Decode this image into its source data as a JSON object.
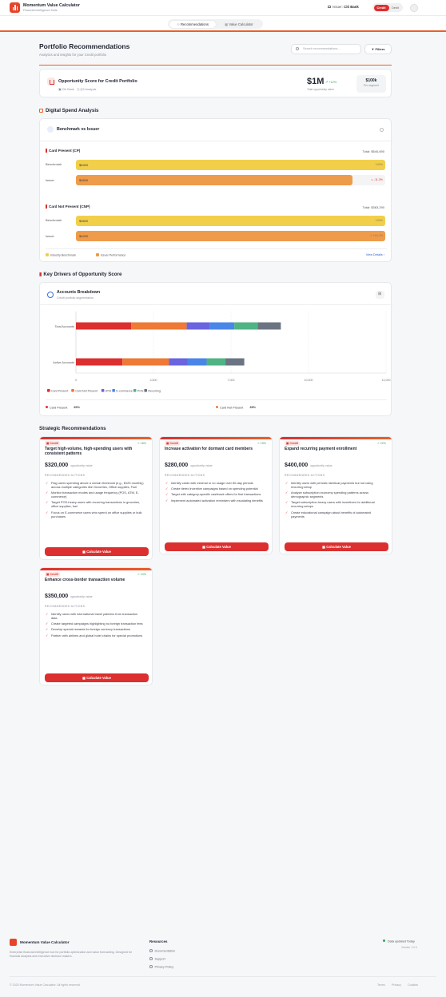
{
  "header": {
    "app_title": "Momentum Value Calculator",
    "app_subtitle": "Financial Intelligence Suite",
    "issuer_label": "Issuer:",
    "issuer_name": "Citi Bank",
    "toggle": {
      "credit": "Credit",
      "debit": "Debit"
    },
    "tabs": [
      {
        "label": "Recommendations"
      },
      {
        "label": "Value Calculator"
      }
    ]
  },
  "page": {
    "title": "Portfolio Recommendations",
    "subtitle": "Analytics and insights for your Credit portfolio",
    "search_placeholder": "Search recommendations...",
    "filters_label": "Filters"
  },
  "opportunity": {
    "title": "Opportunity Score for Credit Portfolio",
    "bank": "Citi Bank",
    "period": "Q3 Analysis",
    "value": "$1M",
    "delta": "+12%",
    "value_label": "Total opportunity value",
    "segment_value": "$100k",
    "segment_label": "Per segment"
  },
  "digital_spend": {
    "section_title": "Digital Spend Analysis",
    "card_title": "Benchmark vs Issuer",
    "groups": [
      {
        "title": "Card Present (CP)",
        "total": "Total: $540,690",
        "rows": [
          {
            "label": "Benchmark",
            "value": "$6400",
            "pct_text": "100%",
            "fill": 1.0,
            "color": "#f2cf4a"
          },
          {
            "label": "Issuer",
            "value": "$4600",
            "pct_text": "↘ -11.3%",
            "fill": 0.895,
            "color": "#ee9b4b"
          }
        ]
      },
      {
        "title": "Card Not Present (CNP)",
        "total": "Total: $363,290",
        "rows": [
          {
            "label": "Benchmark",
            "value": "$3600",
            "pct_text": "100%",
            "fill": 1.0,
            "color": "#f2cf4a"
          },
          {
            "label": "Issuer",
            "value": "$4200",
            "pct_text": "↗ +16.7%",
            "fill": 1.0,
            "color": "#ee9b4b"
          }
        ]
      }
    ],
    "legend": [
      {
        "label": "Industry Benchmark",
        "color": "#f2cf4a"
      },
      {
        "label": "Issuer Performance",
        "color": "#ee9b4b"
      }
    ],
    "view_details": "View Details ›"
  },
  "key_drivers": {
    "section_title": "Key Drivers of Opportunity Score",
    "card_title": "Accounts Breakdown",
    "card_subtitle": "Credit portfolio segmentation",
    "footer": [
      {
        "label": "Card Present",
        "value": "89%",
        "color": "#dc2f2f"
      },
      {
        "label": "Card Not Present",
        "value": "38%",
        "color": "#ee7a35"
      }
    ]
  },
  "chart_data": {
    "type": "bar",
    "orientation": "horizontal",
    "stacked": true,
    "categories": [
      "Total Accounts",
      "Active Accounts"
    ],
    "series": [
      {
        "name": "Card Present",
        "color": "#dc2f2f",
        "values": [
          2500,
          2100
        ]
      },
      {
        "name": "Card Not Present",
        "color": "#ee7a35",
        "values": [
          2500,
          2100
        ]
      },
      {
        "name": "ATM",
        "color": "#6a64e0",
        "values": [
          1050,
          850
        ]
      },
      {
        "name": "E-commerce",
        "color": "#4a86e8",
        "values": [
          1100,
          850
        ]
      },
      {
        "name": "POS",
        "color": "#4fb483",
        "values": [
          1050,
          850
        ]
      },
      {
        "name": "Recurring",
        "color": "#6b7483",
        "values": [
          1050,
          850
        ]
      }
    ],
    "xlim": [
      0,
      14000
    ],
    "xticks": [
      "0",
      "3,500",
      "7,000",
      "10,500",
      "14,000"
    ],
    "grid": true,
    "legend_position": "bottom-left"
  },
  "strategic": {
    "section_title": "Strategic Recommendations",
    "button_label": "Calculate Value",
    "value_suffix": "opportunity value",
    "actions_heading": "RECOMMENDED ACTIONS",
    "cards": [
      {
        "badge": "Credit",
        "growth": "↗ 18%",
        "title": "Target high-volume, high-spending users with consistent patterns",
        "value": "$320,000",
        "actions": [
          "Flag users spending above a certain threshold (e.g., $125 monthly) across multiple categories like Groceries, Office supplies, Fuel",
          "Monitor transaction modes and usage frequency (POS, ATM, E-commerce)",
          "Target POS-heavy users with recurring transactions in groceries, office supplies, fuel",
          "Focus on E-commerce users who spend on office supplies or bulk purchases"
        ]
      },
      {
        "badge": "Credit",
        "growth": "↗ 15%",
        "title": "Increase activation for dormant card members",
        "value": "$280,000",
        "actions": [
          "Identify cards with minimal or no usage over 60-day periods",
          "Create tiered incentive campaigns based on spending potential",
          "Target with category-specific cashback offers for first transactions",
          "Implement automated activation reminders with escalating benefits"
        ]
      },
      {
        "badge": "Credit",
        "growth": "↗ 22%",
        "title": "Expand recurring payment enrollment",
        "value": "$400,000",
        "actions": [
          "Identify users with periodic identical payments but not using recurring setup",
          "Analyze subscription economy spending patterns across demographic segments",
          "Target subscription-heavy users with incentives for additional recurring setups",
          "Create educational campaign about benefits of automated payments"
        ]
      },
      {
        "badge": "Credit",
        "growth": "↗ 10%",
        "title": "Enhance cross-border transaction volume",
        "value": "$350,000",
        "actions": [
          "Identify users with international travel patterns from transaction data",
          "Create targeted campaigns highlighting no foreign transaction fees",
          "Develop special rewards for foreign currency transactions",
          "Partner with airlines and global hotel chains for special promotions"
        ]
      }
    ]
  },
  "footer": {
    "name": "Momentum Value Calculator",
    "description": "Enterprise financial intelligence tool for portfolio optimization and value forecasting. Designed for financial analysts and executive decision makers.",
    "resources_title": "Resources",
    "resources": [
      "Documentation",
      "Support",
      "Privacy Policy"
    ],
    "status": "Data updated Today",
    "version": "Version 1.0.0",
    "copyright": "© 2025 Momentum Value Calculator. All rights reserved.",
    "links": [
      "Terms",
      "Privacy",
      "Cookies"
    ]
  },
  "colors": {
    "accent": "#dc2f2f",
    "brand_orange": "#e9602b",
    "success": "#2fa561",
    "link": "#2b62d9"
  }
}
